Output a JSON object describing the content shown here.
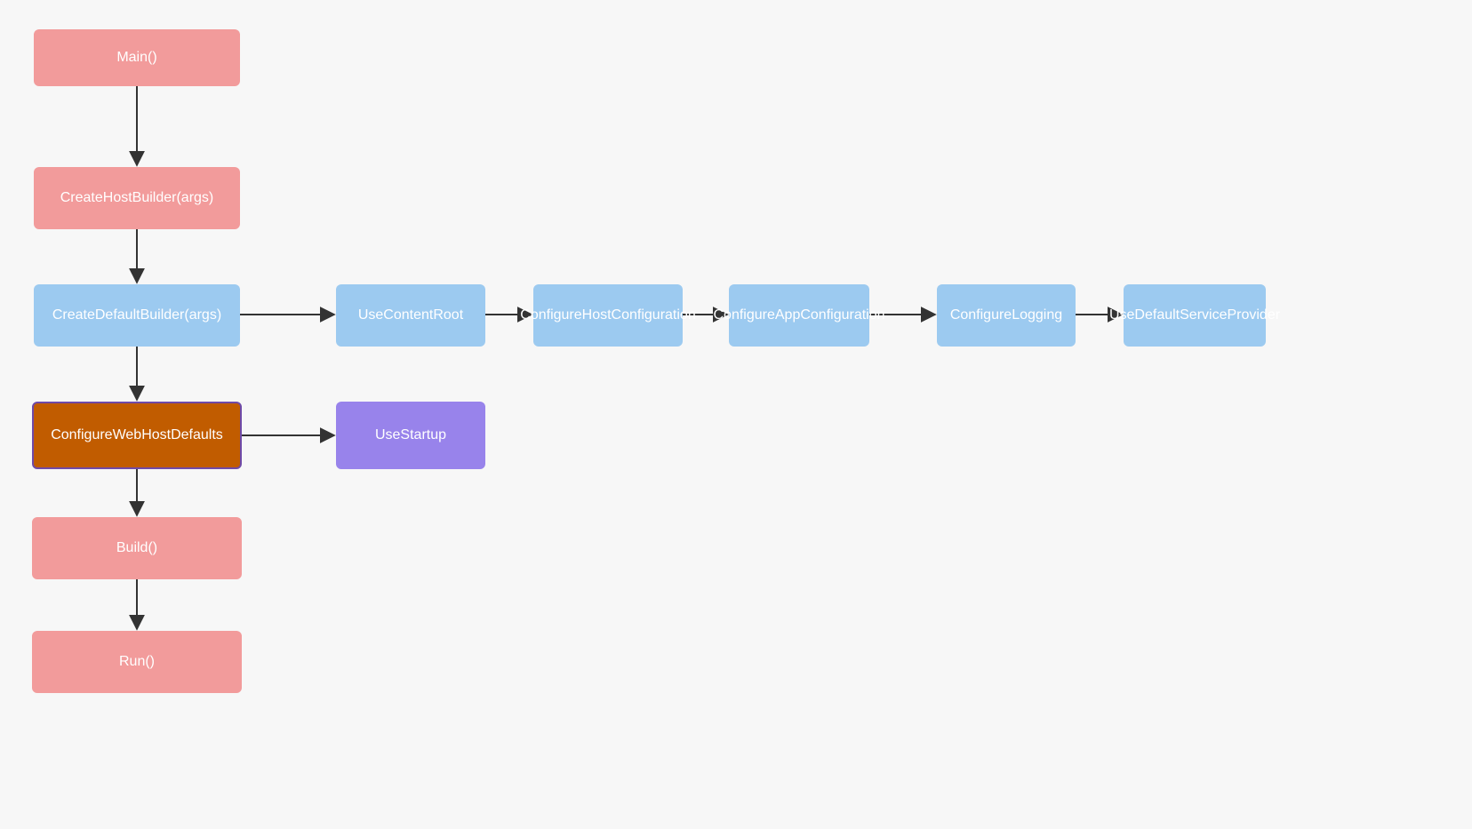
{
  "nodes": {
    "main": {
      "label": "Main()"
    },
    "createHost": {
      "label": "CreateHostBuilder(args)"
    },
    "createDef": {
      "label": "CreateDefaultBuilder(args)"
    },
    "useContent": {
      "label": "UseContentRoot"
    },
    "confHost": {
      "label": "ConfigureHostConfiguration"
    },
    "confApp": {
      "label": "ConfigureAppConfiguration"
    },
    "confLog": {
      "label": "ConfigureLogging"
    },
    "useDefSvc": {
      "label": "UseDefaultServiceProvider"
    },
    "confWeb": {
      "label": "ConfigureWebHostDefaults"
    },
    "useStartup": {
      "label": "UseStartup"
    },
    "build": {
      "label": "Build()"
    },
    "run": {
      "label": "Run()"
    }
  },
  "colors": {
    "pink": "#f29b9b",
    "blue": "#9ccaf0",
    "purple": "#9883eb",
    "orange": "#c15c00",
    "selectedBorder": "#6f4aa8"
  },
  "edges": [
    [
      "main",
      "createHost"
    ],
    [
      "createHost",
      "createDef"
    ],
    [
      "createDef",
      "useContent"
    ],
    [
      "useContent",
      "confHost"
    ],
    [
      "confHost",
      "confApp"
    ],
    [
      "confApp",
      "confLog"
    ],
    [
      "confLog",
      "useDefSvc"
    ],
    [
      "createDef",
      "confWeb"
    ],
    [
      "confWeb",
      "useStartup"
    ],
    [
      "confWeb",
      "build"
    ],
    [
      "build",
      "run"
    ]
  ]
}
